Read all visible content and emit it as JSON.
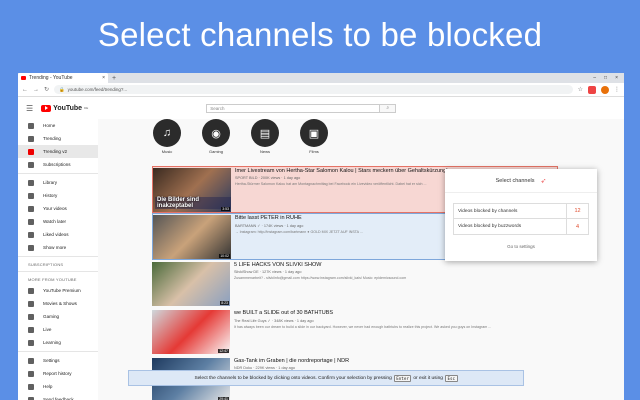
{
  "headline": "Select channels to be blocked",
  "browser": {
    "tab_title": "Trending - YouTube",
    "url": "youtube.com/feed/trending?...",
    "tab_close": "×",
    "tab_new": "+",
    "window_controls": [
      "–",
      "□",
      "×"
    ]
  },
  "youtube": {
    "logo_text": "YouTube",
    "logo_sup": "DE",
    "search_placeholder": "Search",
    "search_button": "⌕"
  },
  "sidebar": {
    "main": [
      {
        "label": "Home",
        "active": false
      },
      {
        "label": "Trending",
        "active": false
      },
      {
        "label": "Trending v2",
        "active": true
      },
      {
        "label": "Subscriptions",
        "active": false
      }
    ],
    "library": [
      {
        "label": "Library"
      },
      {
        "label": "History"
      },
      {
        "label": "Your videos"
      },
      {
        "label": "Watch later"
      },
      {
        "label": "Liked videos"
      },
      {
        "label": "Show more"
      }
    ],
    "subscriptions_header": "SUBSCRIPTIONS",
    "more_header": "MORE FROM YOUTUBE",
    "more": [
      {
        "label": "YouTube Premium"
      },
      {
        "label": "Movies & Shows"
      },
      {
        "label": "Gaming"
      },
      {
        "label": "Live"
      },
      {
        "label": "Learning"
      }
    ],
    "settings": [
      {
        "label": "Settings"
      },
      {
        "label": "Report history"
      },
      {
        "label": "Help"
      },
      {
        "label": "Send feedback"
      }
    ]
  },
  "categories": [
    {
      "label": "Music",
      "icon": "♫"
    },
    {
      "label": "Gaming",
      "icon": "◉"
    },
    {
      "label": "News",
      "icon": "▤"
    },
    {
      "label": "Films",
      "icon": "▣"
    }
  ],
  "videos": [
    {
      "title": "Imer Livestream von Hertha-Star Salomon Kalou | Stars meckern über Gehaltskürzung!",
      "channel": "SPORT BILD · 200K views · 1 day ago",
      "desc": "Hertha-Stürmer Salomon Kalou hat am Montagnachmittag bei Facebook ein Livevideo veröffentlicht. Dabei hat er sich ...",
      "caption": "Die Bilder sind inakzeptabel",
      "duration": "3:53",
      "highlight": "red"
    },
    {
      "title": "Bitte lasst PETER in RUHE",
      "channel": "BARTMANN ✓ · 174K views · 1 day ago",
      "desc": "→ Instagram: http://instagram.com/bartmann ● GOLD MIX JETZT AUF INSTA ...",
      "caption": "",
      "duration": "10:02",
      "highlight": "blue"
    },
    {
      "title": "5 LIFE HACKS VON SLIVKI SHOW",
      "channel": "SlivkiShow DE · 127K views · 1 day ago",
      "desc": "Zusammenarbeit? - slivkiinfo@gmail.com https://www.instagram.com/slivki_kais/ Music: epidemicsound.com",
      "caption": "",
      "duration": "8:23",
      "highlight": "none"
    },
    {
      "title": "we BUILT a SLIDE out of 30 BATHTUBS",
      "channel": "The Real Life Guys ✓ · 348K views · 1 day ago",
      "desc": "It has always been our dream to build a slide in our backyard. However, we never had enough bathtubs to realize this project. We asked you guys on Instagram ...",
      "caption": "",
      "duration": "12:47",
      "highlight": "none"
    },
    {
      "title": "Gas-Tank im Graben | die nordreportage | NDR",
      "channel": "NDR Doku · 229K views · 1 day ago",
      "desc": "",
      "caption": "",
      "duration": "29:41",
      "highlight": "none"
    }
  ],
  "popup": {
    "title": "Select channels",
    "rows": [
      {
        "label": "Videos blocked by channels",
        "value": "12"
      },
      {
        "label": "Videos blocked by buzzwords",
        "value": "4"
      }
    ],
    "link": "Go to settings"
  },
  "banner": {
    "text_a": "Select the channels to be blocked by clicking onto videos. Confirm your selection by pressing",
    "key1": "Enter",
    "text_b": "or exit it using",
    "key2": "Esc"
  },
  "colors": {
    "background": "#5b8fe6",
    "blocked_red": "#e57366",
    "selected_blue": "#7ea7db",
    "count_red": "#e04b2c"
  }
}
